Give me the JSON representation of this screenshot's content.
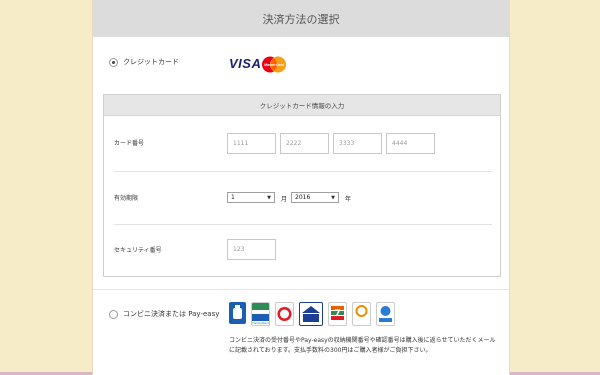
{
  "panel": {
    "title": "決済方法の選択"
  },
  "methods": {
    "credit": {
      "label": "クレジットカード",
      "selected": true
    },
    "convenience": {
      "label": "コンビニ決済または Pay-easy",
      "selected": false
    }
  },
  "card_brands": {
    "visa": "VISA",
    "mastercard": "MasterCard"
  },
  "card_form": {
    "title": "クレジットカード情報の入力",
    "number_label": "カード番号",
    "number_placeholders": [
      "1111",
      "2222",
      "3333",
      "4444"
    ],
    "expiry_label": "有効期限",
    "month_value": "1",
    "month_unit": "月",
    "year_value": "2016",
    "year_unit": "年",
    "security_label": "セキュリティ番号",
    "security_placeholder": "123"
  },
  "convenience_stores": [
    {
      "icon": "lawson-icon",
      "color": "#1a5fb4",
      "text": ""
    },
    {
      "icon": "familymart-icon",
      "color": "#2e8b57",
      "text": "FamilyMart"
    },
    {
      "icon": "circle-k-icon",
      "color": "#e01b24",
      "text": "K"
    },
    {
      "icon": "ministop-icon",
      "color": "#1c3f95",
      "text": "MINI STOP"
    },
    {
      "icon": "seven-eleven-icon",
      "color": "#e66100",
      "text": "7"
    },
    {
      "icon": "daily-yamazaki-icon",
      "color": "#f08c00",
      "text": "Daily Yamazaki"
    },
    {
      "icon": "pay-easy-icon",
      "color": "#2a7bd6",
      "text": "Pay-easy"
    }
  ],
  "convenience_note": "コンビニ決済の受付番号やPay-easyの収納機関番号や確認番号は購入後に返らせていただくメールに記載されております。支払手数料の300円はご購入者様がご負担下さい。"
}
